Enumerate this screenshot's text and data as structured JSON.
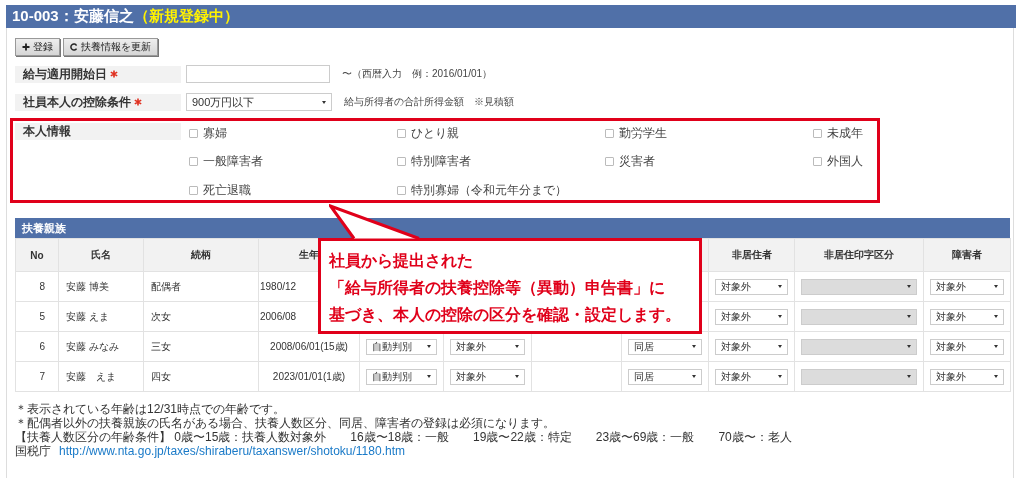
{
  "header": {
    "title": "10-003：安藤信之",
    "status": "（新規登録中）"
  },
  "toolbar": [
    {
      "kind": "add",
      "label": "登録"
    },
    {
      "kind": "refresh",
      "label": "扶養情報を更新"
    }
  ],
  "salary_start": {
    "label": "給与適用開始日",
    "required": true,
    "hint": "〜（西暦入力　例：2016/01/01）"
  },
  "deduction_condition": {
    "label": "社員本人の控除条件",
    "required": true,
    "value": "900万円以下",
    "hint": "給与所得者の合計所得金額　※見積額"
  },
  "personal_info": {
    "label": "本人情報",
    "options": [
      {
        "label": "寡婦",
        "checked": false
      },
      {
        "label": "ひとり親",
        "checked": false
      },
      {
        "label": "勤労学生",
        "checked": false
      },
      {
        "label": "未成年",
        "checked": false
      },
      {
        "label": "一般障害者",
        "checked": false
      },
      {
        "label": "特別障害者",
        "checked": false
      },
      {
        "label": "災害者",
        "checked": false
      },
      {
        "label": "外国人",
        "checked": false
      },
      {
        "label": "死亡退職",
        "checked": false
      },
      {
        "label": "特別寡婦（令和元年分まで）",
        "checked": false
      }
    ]
  },
  "dependents": {
    "title": "扶養親族",
    "columns": [
      "No",
      "氏名",
      "続柄",
      "生年",
      "非居住者",
      "非居住印字区分",
      "障害者"
    ],
    "rows": [
      {
        "no": "8",
        "name": "安藤 博美",
        "relation": "配偶者",
        "birth": "1980/12",
        "nonresident": "対象外",
        "print_disabled": true,
        "disability": "対象外"
      },
      {
        "no": "5",
        "name": "安藤 えま",
        "relation": "次女",
        "birth": "2006/08",
        "nonresident": "対象外",
        "print_disabled": true,
        "disability": "対象外"
      },
      {
        "no": "6",
        "name": "安藤 みなみ",
        "relation": "三女",
        "birth": "2008/06/01(15歳)",
        "judgement": "自動判別",
        "dependent_type": "対象外",
        "cohabitation": "同居",
        "nonresident": "対象外",
        "print_disabled": true,
        "disability": "対象外"
      },
      {
        "no": "7",
        "name": "安藤　えま",
        "relation": "四女",
        "birth": "2023/01/01(1歳)",
        "judgement": "自動判別",
        "dependent_type": "対象外",
        "cohabitation": "同居",
        "nonresident": "対象外",
        "print_disabled": true,
        "disability": "対象外"
      }
    ]
  },
  "notes": [
    "＊表示されている年齢は12/31時点での年齢です。",
    "＊配偶者以外の扶養親族の氏名がある場合、扶養人数区分、同居、障害者の登録は必須になります。",
    "【扶養人数区分の年齢条件】 0歳〜15歳：扶養人数対象外　　16歳〜18歳：一般　　19歳〜22歳：特定　　23歳〜69歳：一般　　70歳〜：老人"
  ],
  "reference": {
    "label": "国税庁",
    "link": "http://www.nta.go.jp/taxes/shiraberu/taxanswer/shotoku/1180.htm"
  },
  "callout": [
    "社員から提出された",
    "「給与所得者の扶養控除等（異動）申告書」に",
    "基づき、本人の控除の区分を確認・設定します。"
  ]
}
